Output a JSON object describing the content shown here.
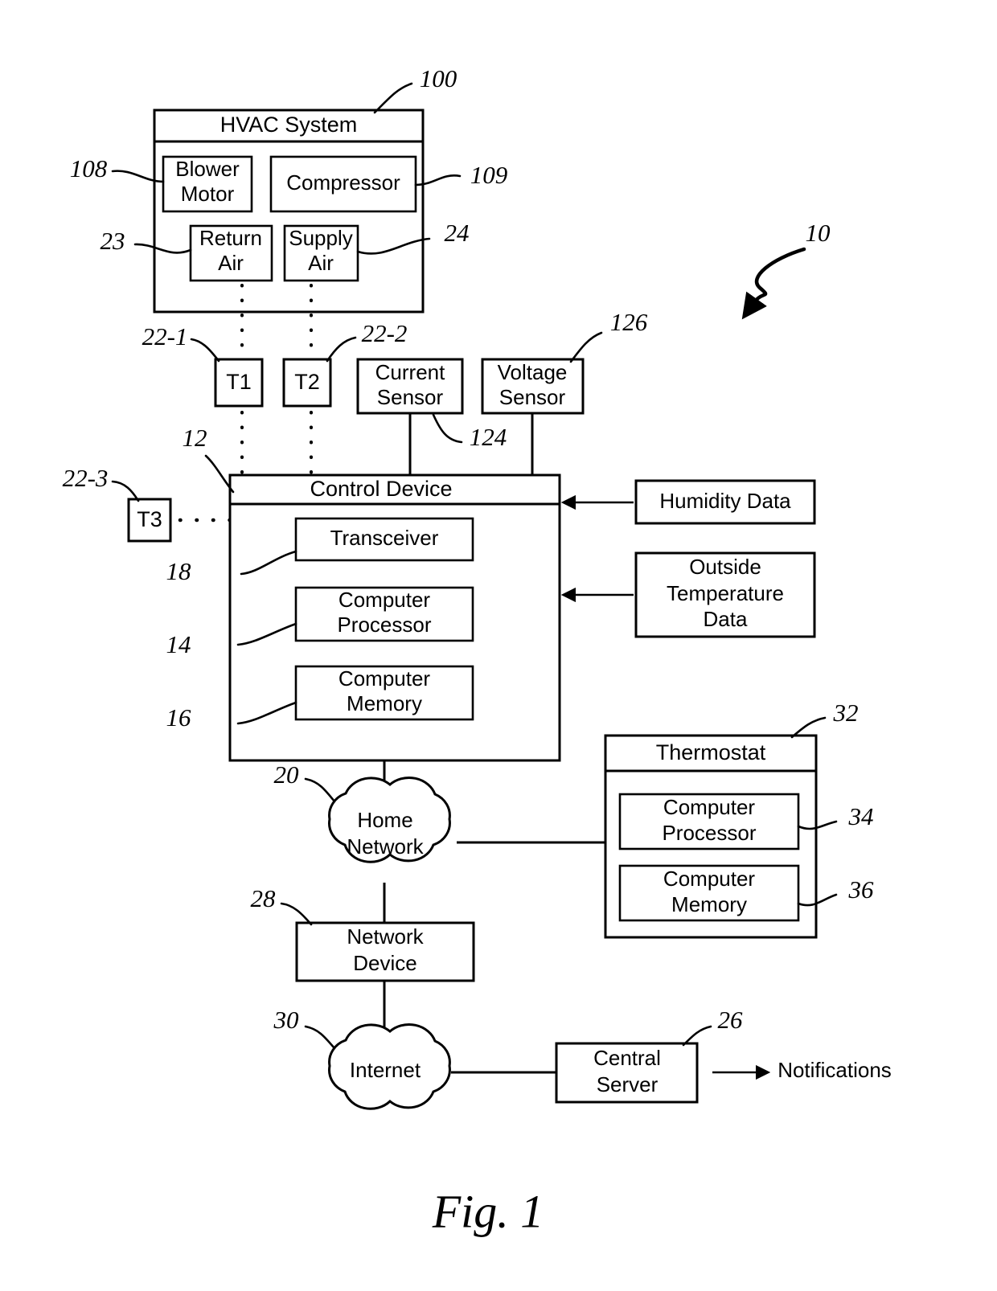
{
  "figure": {
    "caption": "Fig. 1",
    "system_ref": "10"
  },
  "hvac": {
    "title": "HVAC System",
    "ref": "100",
    "components": [
      {
        "label": "Blower\nMotor",
        "line1": "Blower",
        "line2": "Motor",
        "ref": "108"
      },
      {
        "label": "Compressor",
        "line1": "Compressor",
        "line2": "",
        "ref": "109"
      },
      {
        "label": "Return Air",
        "line1": "Return",
        "line2": "Air",
        "ref": "23"
      },
      {
        "label": "Supply Air",
        "line1": "Supply",
        "line2": "Air",
        "ref": "24"
      }
    ]
  },
  "sensors": [
    {
      "label": "T1",
      "ref": "22-1"
    },
    {
      "label": "T2",
      "ref": "22-2"
    },
    {
      "label": "T3",
      "ref": "22-3"
    },
    {
      "line1": "Current",
      "line2": "Sensor",
      "label": "Current Sensor",
      "ref": "124"
    },
    {
      "line1": "Voltage",
      "line2": "Sensor",
      "label": "Voltage Sensor",
      "ref": "126"
    }
  ],
  "control_device": {
    "title": "Control Device",
    "ref": "12",
    "modules": [
      {
        "line1": "Transceiver",
        "line2": "",
        "label": "Transceiver",
        "ref": "18"
      },
      {
        "line1": "Computer",
        "line2": "Processor",
        "label": "Computer Processor",
        "ref": "14"
      },
      {
        "line1": "Computer",
        "line2": "Memory",
        "label": "Computer Memory",
        "ref": "16"
      }
    ]
  },
  "external_data": [
    {
      "line1": "Humidity Data",
      "line2": "",
      "line3": "",
      "label": "Humidity Data"
    },
    {
      "line1": "Outside",
      "line2": "Temperature",
      "line3": "Data",
      "label": "Outside Temperature Data"
    }
  ],
  "thermostat": {
    "title": "Thermostat",
    "ref": "32",
    "modules": [
      {
        "line1": "Computer",
        "line2": "Processor",
        "label": "Computer Processor",
        "ref": "34"
      },
      {
        "line1": "Computer",
        "line2": "Memory",
        "label": "Computer Memory",
        "ref": "36"
      }
    ]
  },
  "network": {
    "home_network": {
      "line1": "Home",
      "line2": "Network",
      "label": "Home Network",
      "ref": "20"
    },
    "network_device": {
      "line1": "Network",
      "line2": "Device",
      "label": "Network Device",
      "ref": "28"
    },
    "internet": {
      "line1": "Internet",
      "label": "Internet",
      "ref": "30"
    },
    "central_server": {
      "line1": "Central",
      "line2": "Server",
      "label": "Central Server",
      "ref": "26"
    },
    "notifications": {
      "label": "Notifications"
    }
  },
  "colors": {
    "stroke": "#000000",
    "background": "#ffffff"
  }
}
